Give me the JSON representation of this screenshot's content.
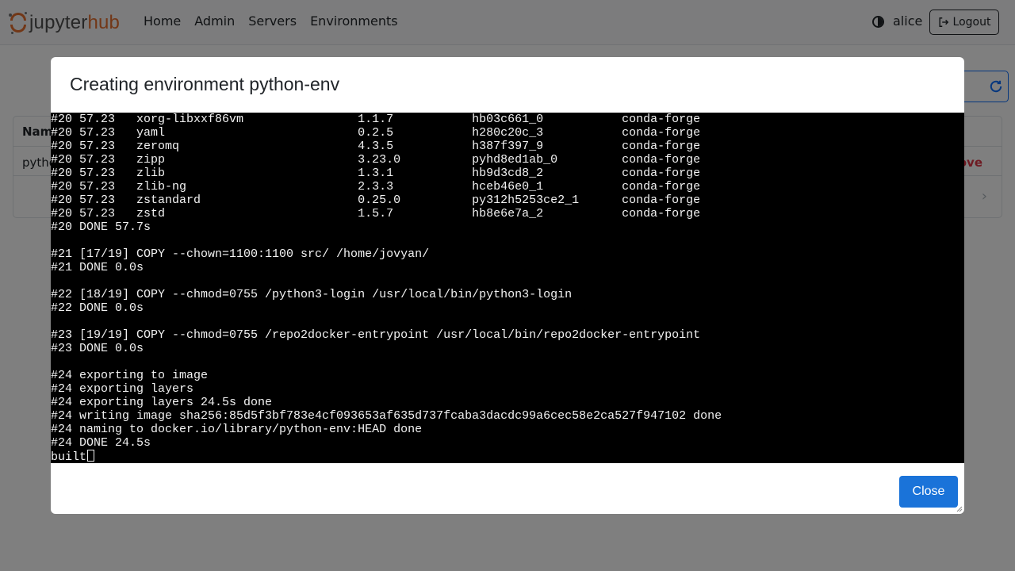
{
  "brand": {
    "name_part1": "jupyter",
    "name_part2": "hub"
  },
  "nav": {
    "items": [
      "Home",
      "Admin",
      "Servers",
      "Environments"
    ]
  },
  "user": {
    "name": "alice",
    "logout_label": "Logout"
  },
  "table": {
    "header_name": "Nam",
    "row_name": "pytho",
    "row_action": "ove"
  },
  "modal": {
    "title": "Creating environment python-env",
    "close_label": "Close",
    "terminal_lines": [
      "#20 57.23   xorg-libxxf86vm                1.1.7           hb03c661_0           conda-forge",
      "#20 57.23   yaml                           0.2.5           h280c20c_3           conda-forge",
      "#20 57.23   zeromq                         4.3.5           h387f397_9           conda-forge",
      "#20 57.23   zipp                           3.23.0          pyhd8ed1ab_0         conda-forge",
      "#20 57.23   zlib                           1.3.1           hb9d3cd8_2           conda-forge",
      "#20 57.23   zlib-ng                        2.3.3           hceb46e0_1           conda-forge",
      "#20 57.23   zstandard                      0.25.0          py312h5253ce2_1      conda-forge",
      "#20 57.23   zstd                           1.5.7           hb8e6e7a_2           conda-forge",
      "#20 DONE 57.7s",
      "",
      "#21 [17/19] COPY --chown=1100:1100 src/ /home/jovyan/",
      "#21 DONE 0.0s",
      "",
      "#22 [18/19] COPY --chmod=0755 /python3-login /usr/local/bin/python3-login",
      "#22 DONE 0.0s",
      "",
      "#23 [19/19] COPY --chmod=0755 /repo2docker-entrypoint /usr/local/bin/repo2docker-entrypoint",
      "#23 DONE 0.0s",
      "",
      "#24 exporting to image",
      "#24 exporting layers",
      "#24 exporting layers 24.5s done",
      "#24 writing image sha256:85d5f3bf783e4cf093653af635d737fcaba3dacdc99a6cec58e2ca527f947102 done",
      "#24 naming to docker.io/library/python-env:HEAD done",
      "#24 DONE 24.5s",
      "built"
    ]
  },
  "colors": {
    "accent": "#1a73d9",
    "brand_orange": "#e46e2e",
    "danger": "#dc3545"
  }
}
